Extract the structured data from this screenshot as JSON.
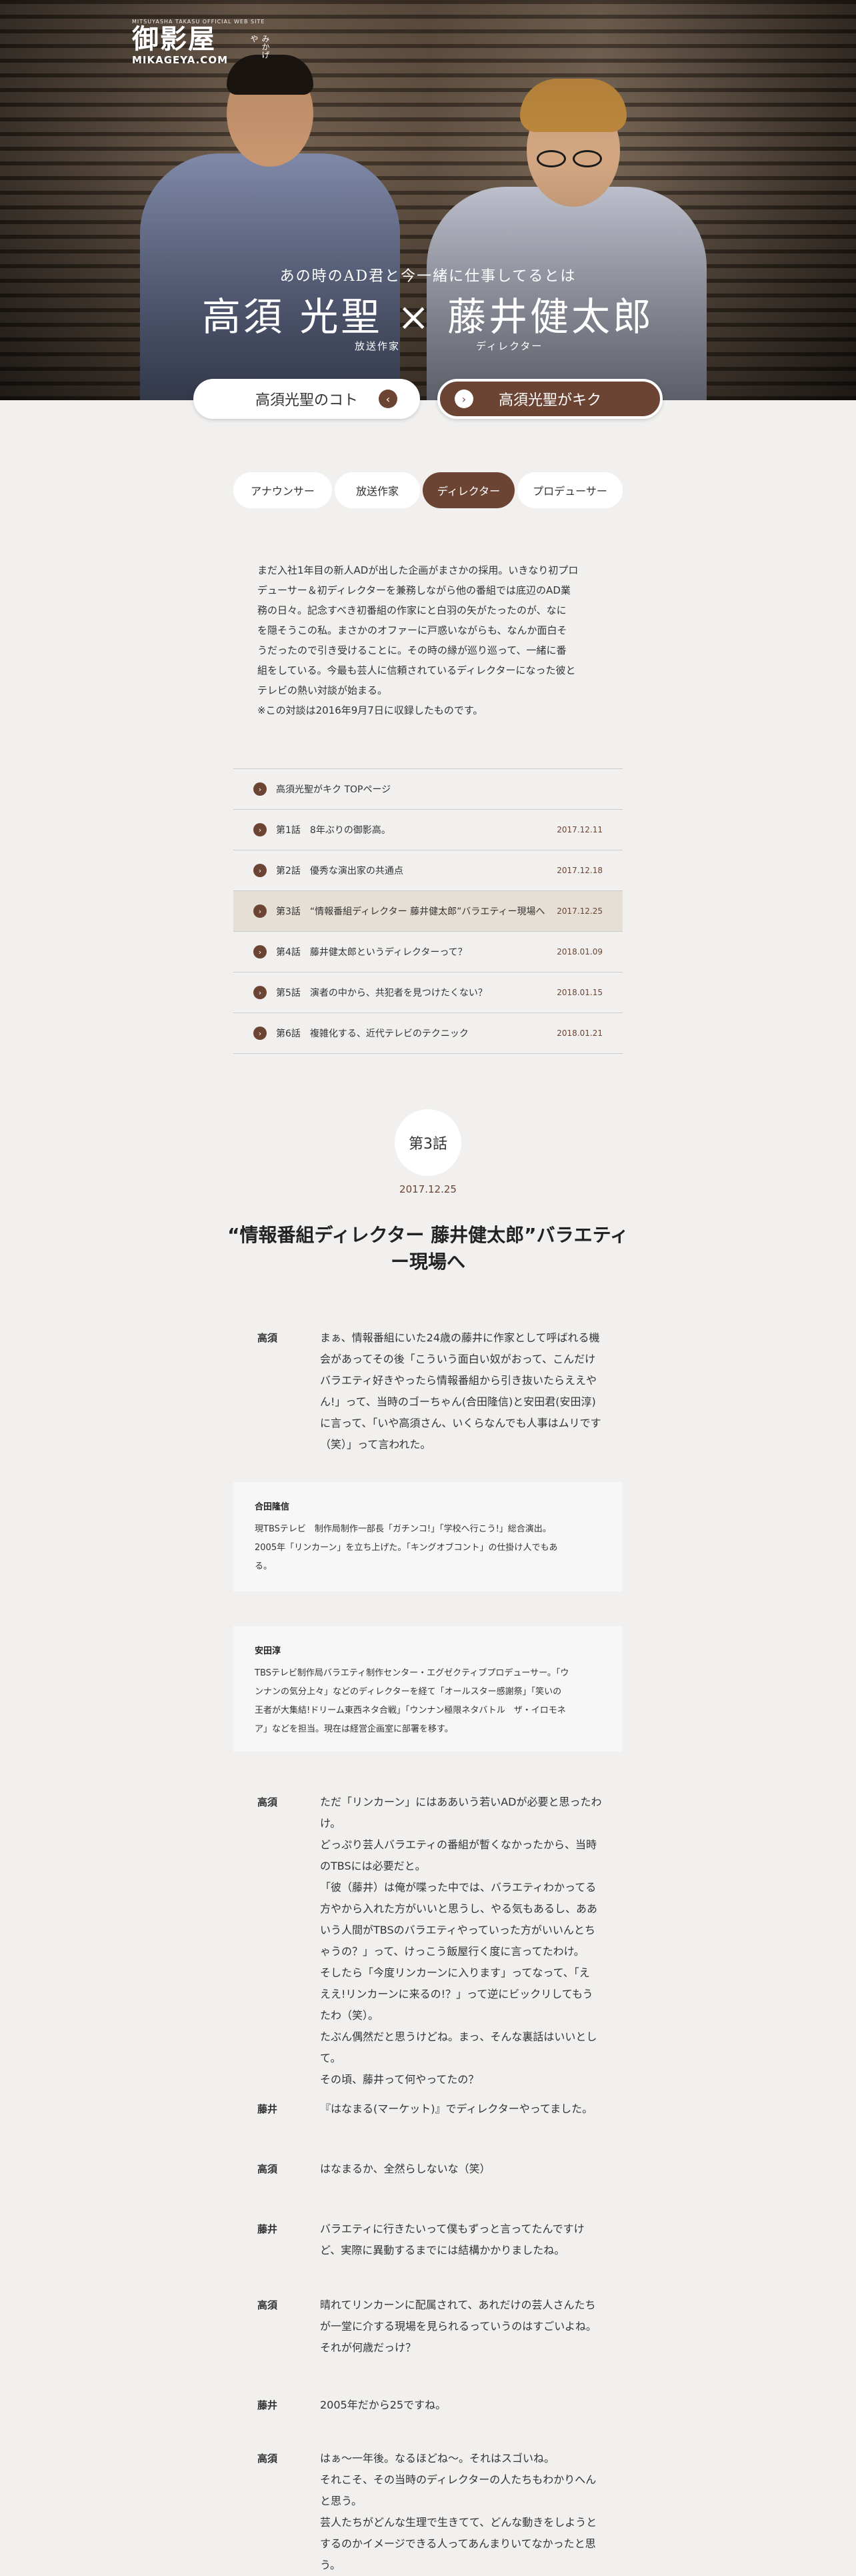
{
  "hero": {
    "logo_small": "MITSUYASHA TAKASU OFFICIAL WEB SITE",
    "logo_main": "御影屋",
    "logo_side": "みかげや",
    "logo_url": "MIKAGEYA.COM",
    "subtitle": "あの時のAD君と今一緒に仕事してるとは",
    "title": "高須 光聖 × 藤井健太郎",
    "role_left": "放送作家",
    "role_right": "ディレクター",
    "btn_left": "高須光聖のコト",
    "btn_right": "高須光聖がキク",
    "btn_left_icon": "chevron-left-icon",
    "btn_right_icon": "chevron-right-icon"
  },
  "categories": [
    "アナウンサー",
    "放送作家",
    "ディレクター",
    "プロデューサー"
  ],
  "active_category": "ディレクター",
  "intro": [
    "まだ入社1年目の新人ADが出した企画がまさかの採用。いきなり初プロ",
    "デューサー＆初ディレクターを兼務しながら他の番組では底辺のAD業",
    "務の日々。記念すべき初番組の作家にと白羽の矢がたったのが、なに",
    "を隠そうこの私。まさかのオファーに戸惑いながらも、なんか面白そ",
    "うだったので引き受けることに。その時の縁が巡り巡って、一緒に番",
    "組をしている。今最も芸人に信頼されているディレクターになった彼と",
    "テレビの熱い対談が始まる。",
    "※この対談は2016年9月7日に収録したものです。"
  ],
  "episodes": [
    {
      "label": "高須光聖がキク TOPページ",
      "date": ""
    },
    {
      "label": "第1話　8年ぶりの御影高。",
      "date": "2017.12.11"
    },
    {
      "label": "第2話　優秀な演出家の共通点",
      "date": "2017.12.18"
    },
    {
      "label": "第3話　“情報番組ディレクター 藤井健太郎”バラエティー現場へ",
      "date": "2017.12.25"
    },
    {
      "label": "第4話　藤井健太郎というディレクターって？",
      "date": "2018.01.09"
    },
    {
      "label": "第5話　演者の中から、共犯者を見つけたくない？",
      "date": "2018.01.15"
    },
    {
      "label": "第6話　複雑化する、近代テレビのテクニック",
      "date": "2018.01.21"
    }
  ],
  "active_episode": 3,
  "episode": {
    "number_label": "第3話",
    "date": "2017.12.25",
    "title": "“情報番組ディレクター 藤井健太郎”バラエティー現場へ"
  },
  "dialogue": [
    {
      "speaker": "高須",
      "lines": [
        "まぁ、情報番組にいた24歳の藤井に作家として呼ばれる機",
        "会があってその後「こういう面白い奴がおって、こんだけ",
        "バラエティ好きやったら情報番組から引き抜いたらええや",
        "ん!」って、当時のゴーちゃん(合田隆信)と安田君(安田淳)",
        "に言って、「いや高須さん、いくらなんでも人事はムリです",
        "（笑）」って言われた。"
      ]
    },
    {
      "speaker": "高須",
      "lines": [
        "ただ「リンカーン」にはああいう若いADが必要と思ったわ",
        "け。",
        "どっぷり芸人バラエティの番組が暫くなかったから、当時",
        "のTBSには必要だと。",
        "「彼（藤井）は俺が喋った中では、バラエティわかってる",
        "方やから入れた方がいいと思うし、やる気もあるし、ああ",
        "いう人間がTBSのバラエティやっていった方がいいんとち",
        "ゃうの？」って、けっこう飯屋行く度に言ってたわけ。",
        "そしたら「今度リンカーンに入ります」ってなって、「え",
        "ええ!リンカーンに来るの!？」って逆にビックリしてもう",
        "たわ（笑）。",
        "たぶん偶然だと思うけどね。まっ、そんな裏話はいいとし",
        "て。",
        "その頃、藤井って何やってたの？"
      ]
    },
    {
      "speaker": "藤井",
      "lines": [
        "『はなまる(マーケット)』でディレクターやってました。"
      ]
    },
    {
      "speaker": "高須",
      "lines": [
        "はなまるか、全然らしないな（笑）"
      ]
    },
    {
      "speaker": "藤井",
      "lines": [
        "バラエティに行きたいって僕もずっと言ってたんですけ",
        "ど、実際に異動するまでには結構かかりましたね。"
      ]
    },
    {
      "speaker": "高須",
      "lines": [
        "晴れてリンカーンに配属されて、あれだけの芸人さんたち",
        "が一堂に介する現場を見られるっていうのはすごいよね。",
        "それが何歳だっけ？"
      ]
    },
    {
      "speaker": "藤井",
      "lines": [
        "2005年だから25ですね。"
      ]
    },
    {
      "speaker": "高須",
      "lines": [
        "はぁ〜一年後。なるほどね〜。それはスゴいね。",
        "それこそ、その当時のディレクターの人たちもわかりへん",
        "と思う。",
        "芸人たちがどんな生理で生きてて、どんな動きをしようと",
        "するのかイメージできる人ってあんまりいてなかったと思",
        "う。"
      ]
    }
  ],
  "notes": [
    {
      "name": "合田隆信",
      "lines": [
        "現TBSテレビ　制作局制作一部長「ガチンコ!」「学校へ行こう!」総合演出。",
        "2005年「リンカーン」を立ち上げた。「キングオブコント」の仕掛け人でもあ",
        "る。"
      ]
    },
    {
      "name": "安田淳",
      "lines": [
        "TBSテレビ制作局バラエティ制作センター・エグゼクティブプロデューサー。「ウ",
        "ンナンの気分上々」などのディレクターを経て「オールスター感謝祭」「笑いの",
        "王者が大集結!ドリーム東西ネタ合戦」「ウンナン極限ネタバトル　ザ・イロモネ",
        "ア」などを担当。現在は経営企画室に部署を移す。"
      ]
    }
  ],
  "colors": {
    "accent": "#6b4434",
    "active_row": "#e6dfd6",
    "background": "#f1f0ef"
  }
}
